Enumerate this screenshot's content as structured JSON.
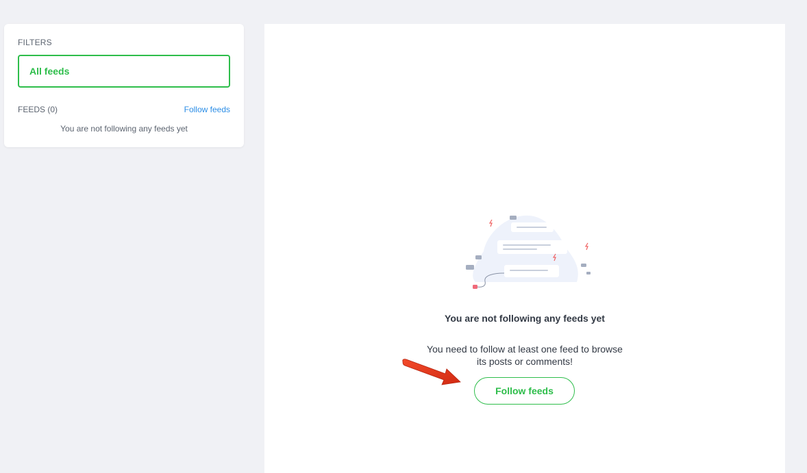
{
  "sidebar": {
    "filters_heading": "FILTERS",
    "filter_all": "All feeds",
    "feeds_heading": "FEEDS (0)",
    "follow_link": "Follow feeds",
    "empty_text": "You are not following any feeds yet"
  },
  "main": {
    "empty_title": "You are not following any feeds yet",
    "empty_desc_line1": "You need to follow at least one feed to browse",
    "empty_desc_line2": "its posts or comments!",
    "follow_button": "Follow feeds"
  },
  "colors": {
    "accent_green": "#2dbd4a",
    "link_blue": "#2b8de6",
    "annotation_arrow": "#e8301c",
    "page_background": "#f0f1f5"
  },
  "icons": {
    "illustration": "empty-feeds-illustration",
    "arrow": "annotation-arrow-icon"
  }
}
